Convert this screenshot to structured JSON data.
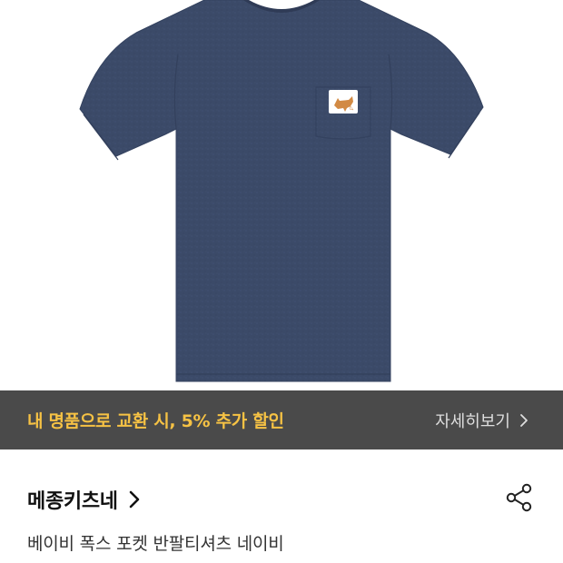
{
  "product_image": {
    "alt": "",
    "icon": "fox-logo-icon",
    "colors": {
      "shirt": "#3b4a68",
      "shirt_shadow": "#334161",
      "background": "#ffffff"
    }
  },
  "promo_banner": {
    "text": "내 명품으로 교환 시, 5% 추가 할인",
    "link_label": "자세히보기",
    "link_icon": "chevron-right-icon",
    "colors": {
      "background": "#4a4a4a",
      "text": "#f6c244",
      "link": "#dedede"
    }
  },
  "product": {
    "brand": "메종키츠네",
    "brand_icon": "chevron-right-icon",
    "share_icon": "share-icon",
    "name": "베이비 폭스 포켓 반팔티셔츠 네이비"
  }
}
